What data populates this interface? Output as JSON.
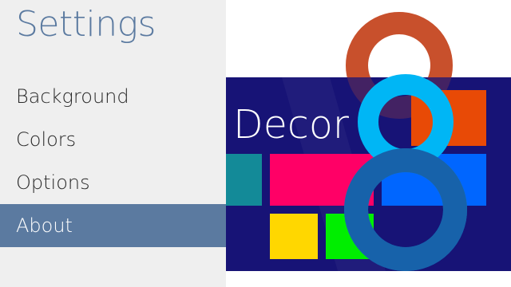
{
  "settings": {
    "title": "Settings",
    "menu": [
      {
        "label": "Background",
        "selected": false
      },
      {
        "label": "Colors",
        "selected": false
      },
      {
        "label": "Options",
        "selected": false
      },
      {
        "label": "About",
        "selected": true
      }
    ]
  },
  "about": {
    "logo_text": "Decor",
    "logo_icon": "figure-eight-logo-icon"
  },
  "colors": {
    "sidebar_background": "#efefef",
    "accent": "#5b7aa0",
    "panel_navy": "#171376",
    "tile_teal": "#138a98",
    "tile_pink": "#ff0066",
    "tile_blue": "#0066ff",
    "tile_yellow": "#ffd700",
    "tile_green": "#00ee00",
    "tile_orange": "#e84a06",
    "logo_cyan": "#00b6f5",
    "logo_ring_orange": "#c9502c"
  }
}
